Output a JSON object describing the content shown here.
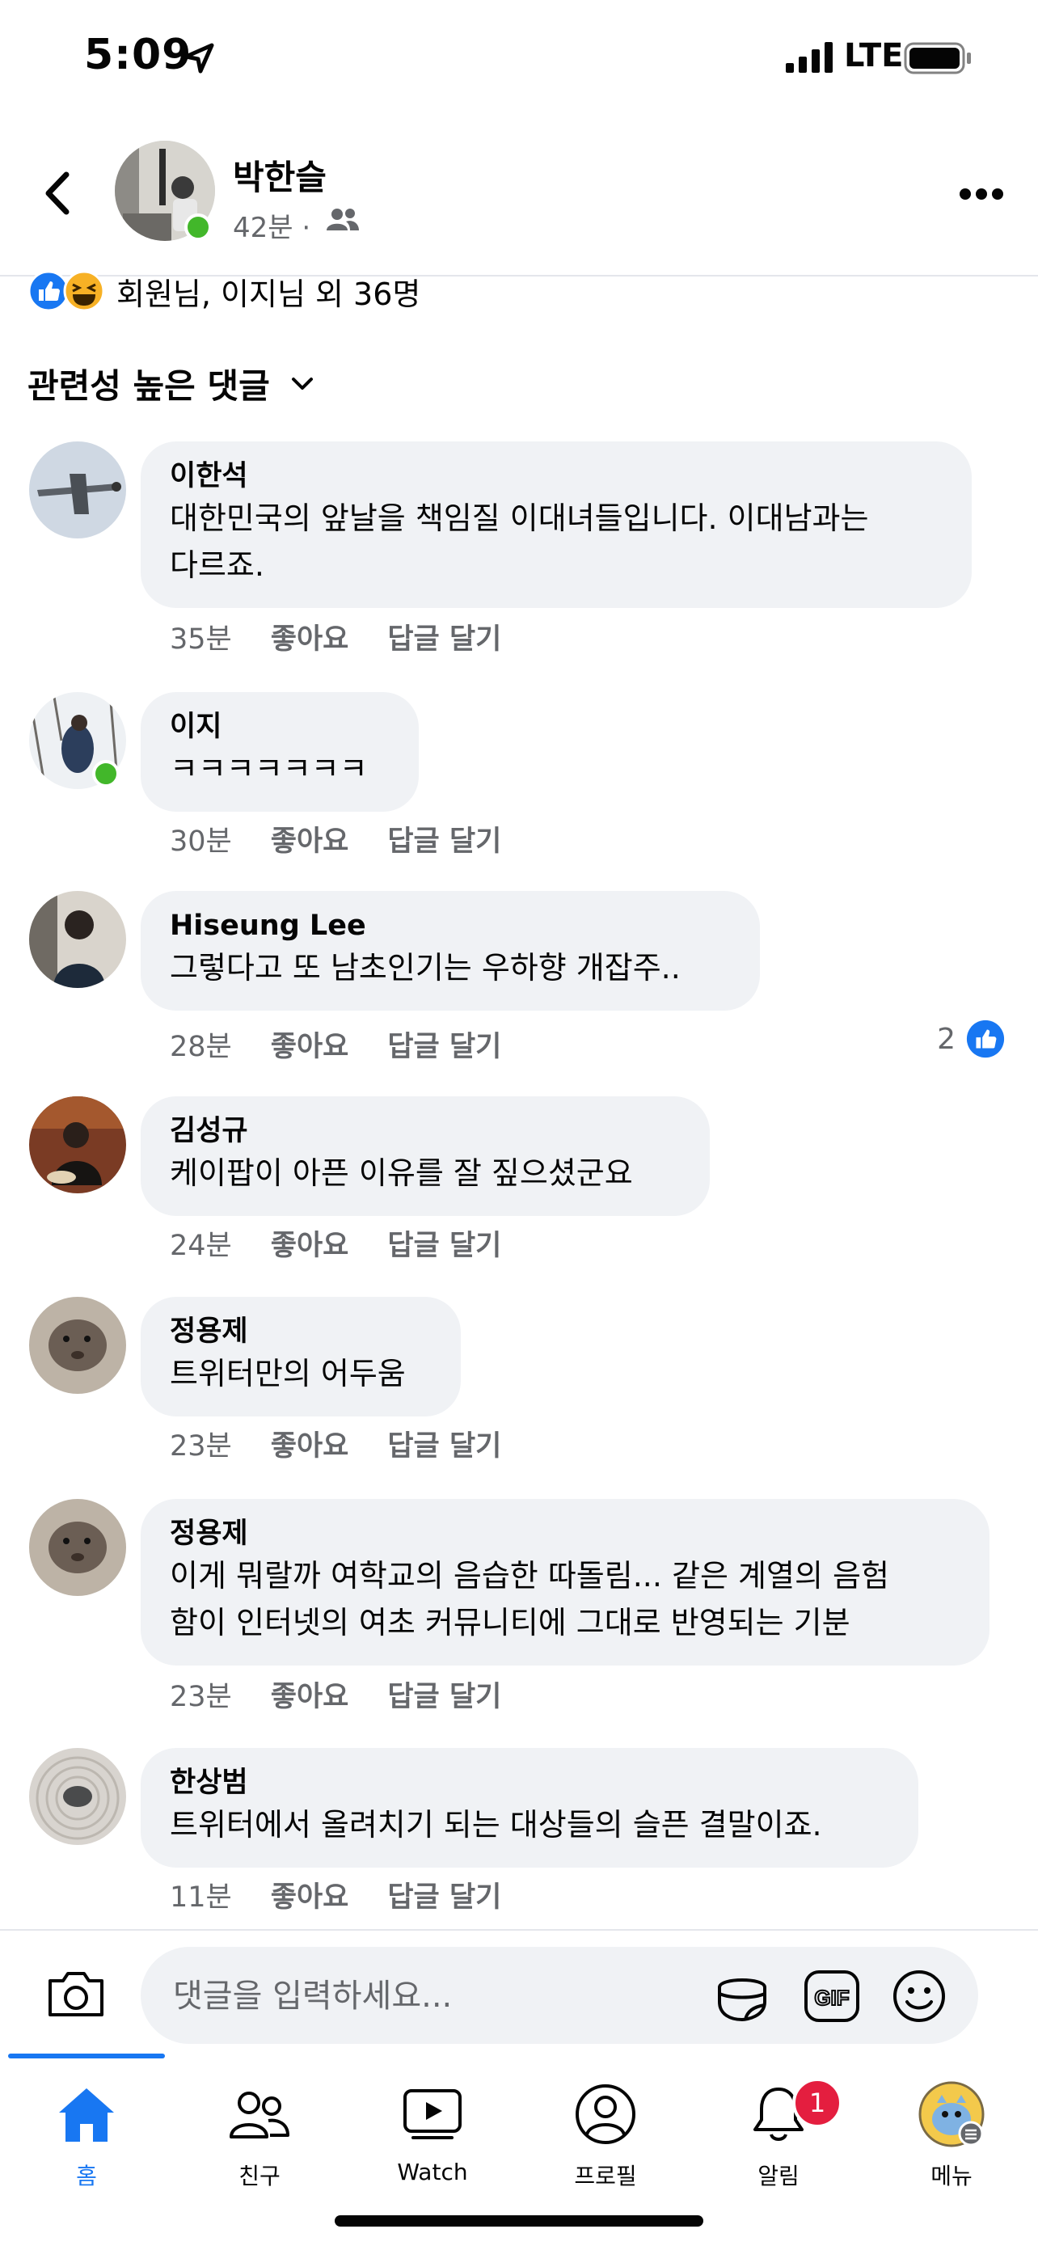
{
  "status_bar": {
    "time": "5:09",
    "network": "LTE"
  },
  "post_header": {
    "author": "박한슬",
    "time": "42분 ·",
    "online": true
  },
  "reactions": {
    "summary": "회원님, 이지님 외 36명"
  },
  "filter": {
    "label": "관련성 높은 댓글"
  },
  "comments": [
    {
      "name": "이한석",
      "lines": [
        "대한민국의 앞날을 책임질 이대녀들입니다. 이대남과는",
        "다르죠."
      ],
      "time": "35분",
      "like": "좋아요",
      "reply": "답글 달기"
    },
    {
      "name": "이지",
      "lines": [
        "ㅋㅋㅋㅋㅋㅋㅋ"
      ],
      "time": "30분",
      "like": "좋아요",
      "reply": "답글 달기",
      "online": true
    },
    {
      "name": "Hiseung Lee",
      "lines": [
        "그렇다고 또 남초인기는 우하향 개잡주.."
      ],
      "time": "28분",
      "like": "좋아요",
      "reply": "답글 달기",
      "like_count": "2"
    },
    {
      "name": "김성규",
      "lines": [
        "케이팝이 아픈 이유를 잘 짚으셨군요"
      ],
      "time": "24분",
      "like": "좋아요",
      "reply": "답글 달기"
    },
    {
      "name": "정용제",
      "lines": [
        "트위터만의 어두움"
      ],
      "time": "23분",
      "like": "좋아요",
      "reply": "답글 달기"
    },
    {
      "name": "정용제",
      "lines": [
        "이게 뭐랄까 여학교의 음습한 따돌림... 같은 계열의 음험",
        "함이 인터넷의 여초 커뮤니티에 그대로 반영되는 기분"
      ],
      "time": "23분",
      "like": "좋아요",
      "reply": "답글 달기"
    },
    {
      "name": "한상범",
      "lines": [
        "트위터에서 올려치기 되는 대상들의 슬픈 결말이죠."
      ],
      "time": "11분",
      "like": "좋아요",
      "reply": "답글 달기"
    }
  ],
  "comment_input": {
    "placeholder": "댓글을 입력하세요..."
  },
  "tabs": [
    {
      "label": "홈",
      "icon": "home-icon",
      "active": true
    },
    {
      "label": "친구",
      "icon": "friends-icon"
    },
    {
      "label": "Watch",
      "icon": "watch-icon"
    },
    {
      "label": "프로필",
      "icon": "profile-icon"
    },
    {
      "label": "알림",
      "icon": "bell-icon",
      "badge": "1"
    },
    {
      "label": "메뉴",
      "icon": "menu-avatar-icon"
    }
  ],
  "colors": {
    "accent": "#1877f2",
    "bubble": "#f0f2f5",
    "muted": "#65676b",
    "online": "#42b72a",
    "badge": "#e41e3f"
  }
}
